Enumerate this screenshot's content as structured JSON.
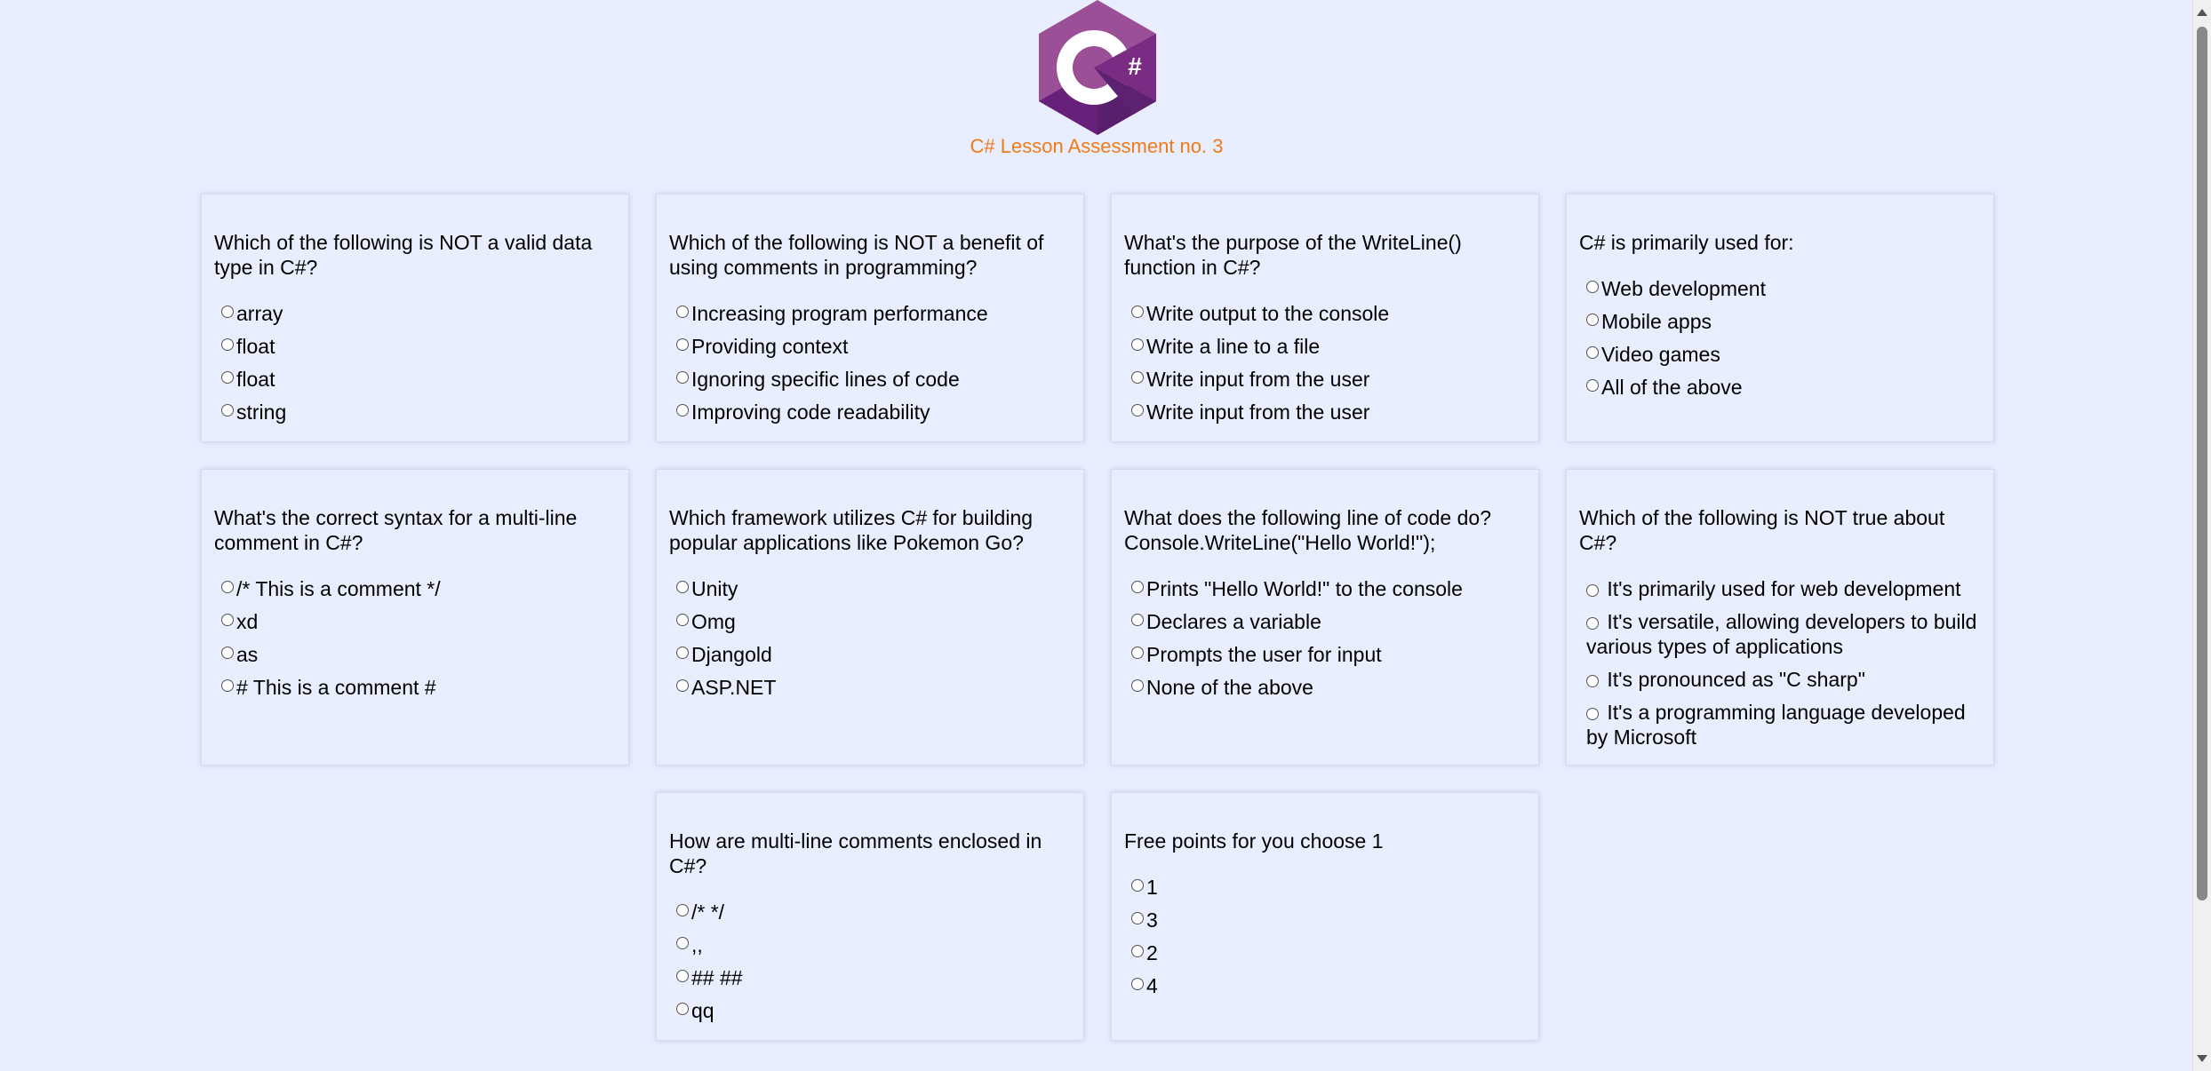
{
  "header": {
    "logo_letter": "C",
    "logo_sharp": "#",
    "title": "C# Lesson Assessment no. 3"
  },
  "colors": {
    "background": "#e8eefe",
    "title": "#f07a17",
    "logo_light": "#9b4f96",
    "logo_mid": "#68217a",
    "logo_dark": "#4b1f63"
  },
  "questions": [
    {
      "text": "Which of the following is NOT a valid data type in C#?",
      "options": [
        "array",
        "float",
        "float",
        "string"
      ]
    },
    {
      "text": "Which of the following is NOT a benefit of using comments in programming?",
      "options": [
        "Increasing program performance",
        "Providing context",
        "Ignoring specific lines of code",
        "Improving code readability"
      ]
    },
    {
      "text": "What's the purpose of the WriteLine() function in C#?",
      "options": [
        "Write output to the console",
        "Write a line to a file",
        "Write input from the user",
        "Write input from the user"
      ]
    },
    {
      "text": "C# is primarily used for:",
      "options": [
        "Web development",
        "Mobile apps",
        "Video games",
        "All of the above"
      ]
    },
    {
      "text": "What's the correct syntax for a multi-line comment in C#?",
      "options": [
        "/* This is a comment */",
        "xd",
        "as",
        "# This is a comment #"
      ]
    },
    {
      "text": "Which framework utilizes C# for building popular applications like Pokemon Go?",
      "options": [
        "Unity",
        "Omg",
        "Djangold",
        "ASP.NET"
      ]
    },
    {
      "text": "What does the following line of code do? Console.WriteLine(\"Hello World!\");",
      "options": [
        "Prints \"Hello World!\" to the console",
        "Declares a variable",
        "Prompts the user for input",
        "None of the above"
      ]
    },
    {
      "text": "Which of the following is NOT true about C#?",
      "options": [
        "It's primarily used for web development",
        "It's versatile, allowing developers to build various types of applications",
        "It's pronounced as \"C sharp\"",
        "It's a programming language developed by Microsoft"
      ]
    },
    {
      "text": "How are multi-line comments enclosed in C#?",
      "options": [
        "/* */",
        ",,",
        "## ##",
        "qq"
      ]
    },
    {
      "text": "Free points for you choose 1",
      "options": [
        "1",
        "3",
        "2",
        "4"
      ]
    }
  ]
}
